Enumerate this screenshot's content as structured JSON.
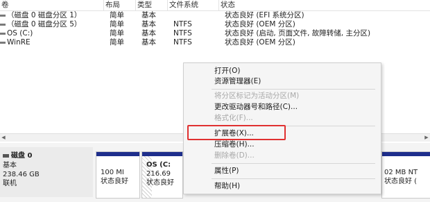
{
  "table": {
    "columns": [
      "卷",
      "布局",
      "类型",
      "文件系统",
      "状态"
    ],
    "rows": [
      {
        "volume": "（磁盘 0 磁盘分区 1）",
        "layout": "简单",
        "type": "基本",
        "fs": "",
        "status": "状态良好 (EFI 系统分区)"
      },
      {
        "volume": "（磁盘 0 磁盘分区 5）",
        "layout": "简单",
        "type": "基本",
        "fs": "NTFS",
        "status": "状态良好 (OEM 分区)"
      },
      {
        "volume": "OS (C:)",
        "layout": "简单",
        "type": "基本",
        "fs": "NTFS",
        "status": "状态良好 (启动, 页面文件, 故障转储, 主分区)"
      },
      {
        "volume": "WinRE",
        "layout": "简单",
        "type": "基本",
        "fs": "NTFS",
        "status": "状态良好 (OEM 分区)"
      }
    ]
  },
  "disk": {
    "name": "磁盘 0",
    "kind": "基本",
    "size": "238.46 GB",
    "state": "联机"
  },
  "partitions": [
    {
      "line1": "100 MI",
      "line2": "状态良好"
    },
    {
      "line1": "OS (C:",
      "line2": "216.69",
      "line3": "状态良好"
    },
    {
      "line1": "02 MB NT",
      "line2": "状态良好 ("
    }
  ],
  "context_menu": {
    "items": [
      {
        "label": "打开(O)",
        "enabled": true
      },
      {
        "label": "资源管理器(E)",
        "enabled": true
      },
      {
        "label": "将分区标记为活动分区(M)",
        "enabled": false
      },
      {
        "label": "更改驱动器号和路径(C)...",
        "enabled": true
      },
      {
        "label": "格式化(F)...",
        "enabled": false
      },
      {
        "label": "扩展卷(X)...",
        "enabled": true
      },
      {
        "label": "压缩卷(H)...",
        "enabled": true
      },
      {
        "label": "删除卷(D)...",
        "enabled": false
      },
      {
        "label": "属性(P)",
        "enabled": true
      },
      {
        "label": "帮助(H)",
        "enabled": true
      }
    ]
  },
  "colors": {
    "partition_bar": "#1e2e8c",
    "highlight_box": "#e03030"
  }
}
